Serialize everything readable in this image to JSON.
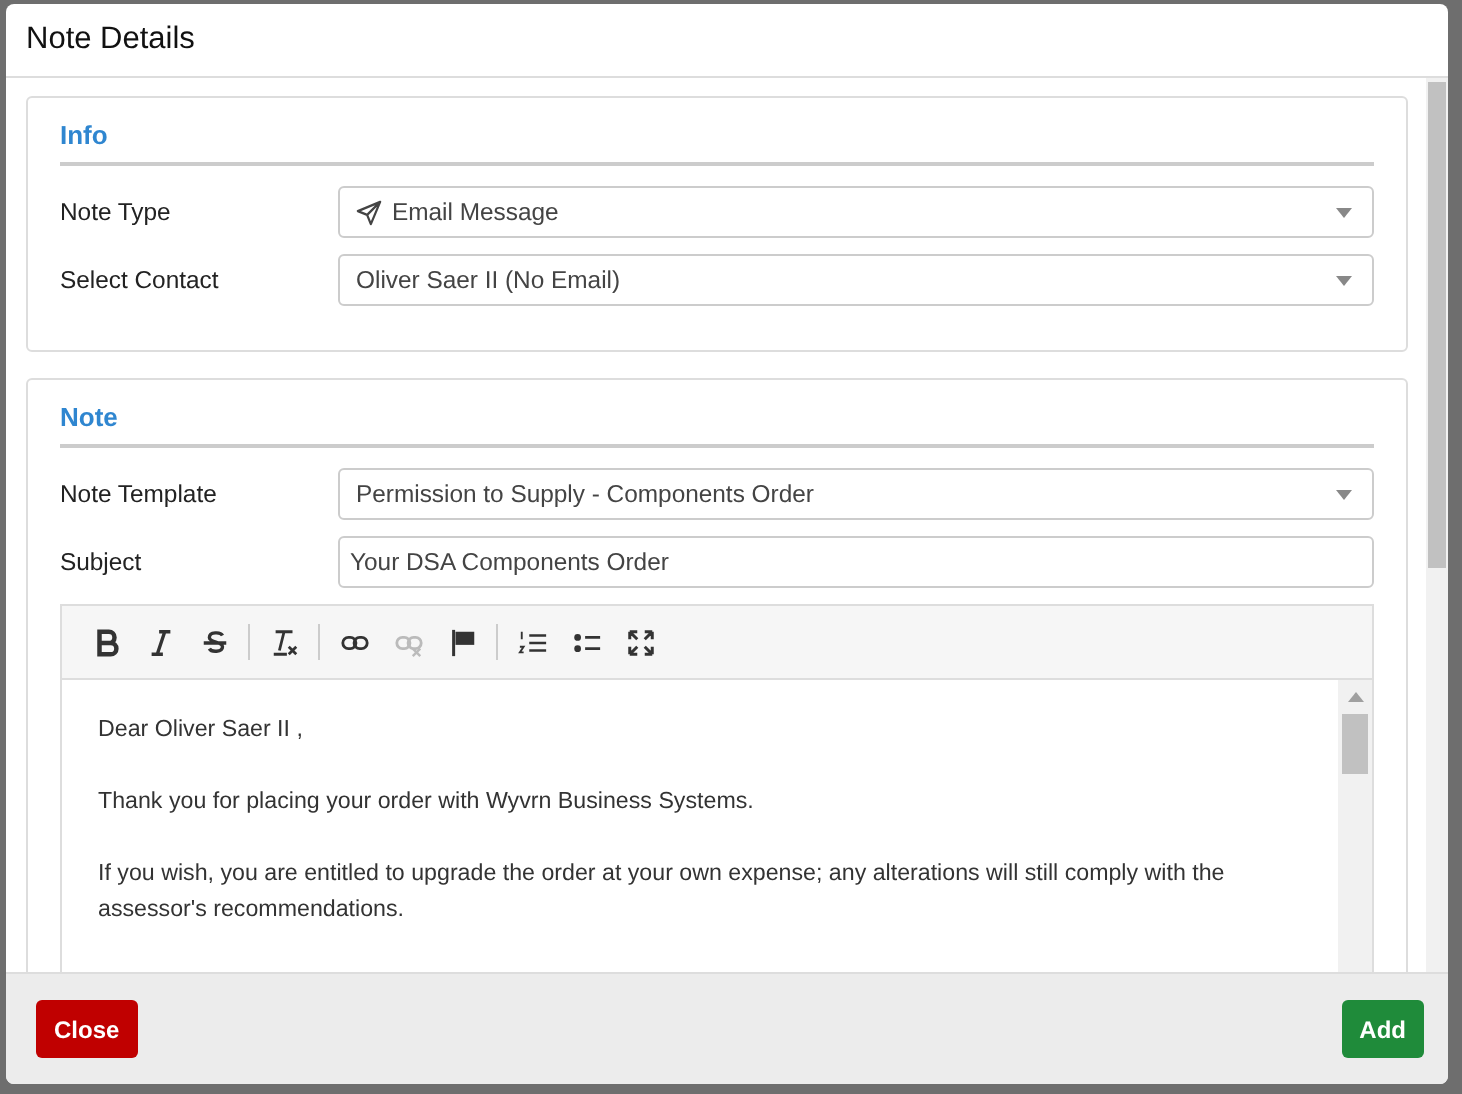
{
  "dialog": {
    "title": "Note Details"
  },
  "info": {
    "heading": "Info",
    "fields": [
      {
        "label": "Note Type",
        "value": "Email Message",
        "kind": "icon-select"
      },
      {
        "label": "Select Contact",
        "value": "Oliver Saer II (No Email)",
        "kind": "select"
      }
    ]
  },
  "note": {
    "heading": "Note",
    "fields": [
      {
        "label": "Note Template",
        "value": "Permission to Supply - Components Order",
        "kind": "select"
      },
      {
        "label": "Subject",
        "value": "Your DSA Components Order",
        "kind": "text"
      }
    ],
    "toolbar": [
      {
        "kind": "bold",
        "disabled": false
      },
      {
        "kind": "italic",
        "disabled": false
      },
      {
        "kind": "strike",
        "disabled": false
      },
      {
        "kind": "separator"
      },
      {
        "kind": "clear-format",
        "disabled": false
      },
      {
        "kind": "separator"
      },
      {
        "kind": "link",
        "disabled": false
      },
      {
        "kind": "unlink",
        "disabled": true
      },
      {
        "kind": "flag",
        "disabled": false
      },
      {
        "kind": "separator"
      },
      {
        "kind": "ordered-list",
        "disabled": false
      },
      {
        "kind": "bullet-list",
        "disabled": false
      },
      {
        "kind": "maximize",
        "disabled": false
      }
    ],
    "body": [
      "Dear Oliver Saer II ,",
      "Thank you for placing your order with Wyvrn Business Systems.",
      "If you wish, you are entitled to upgrade the order at your own expense; any alterations will still comply with the assessor's recommendations."
    ]
  },
  "footer": {
    "buttons": [
      {
        "label": "Close",
        "kind": "danger"
      },
      {
        "label": "Add",
        "kind": "success"
      }
    ]
  }
}
